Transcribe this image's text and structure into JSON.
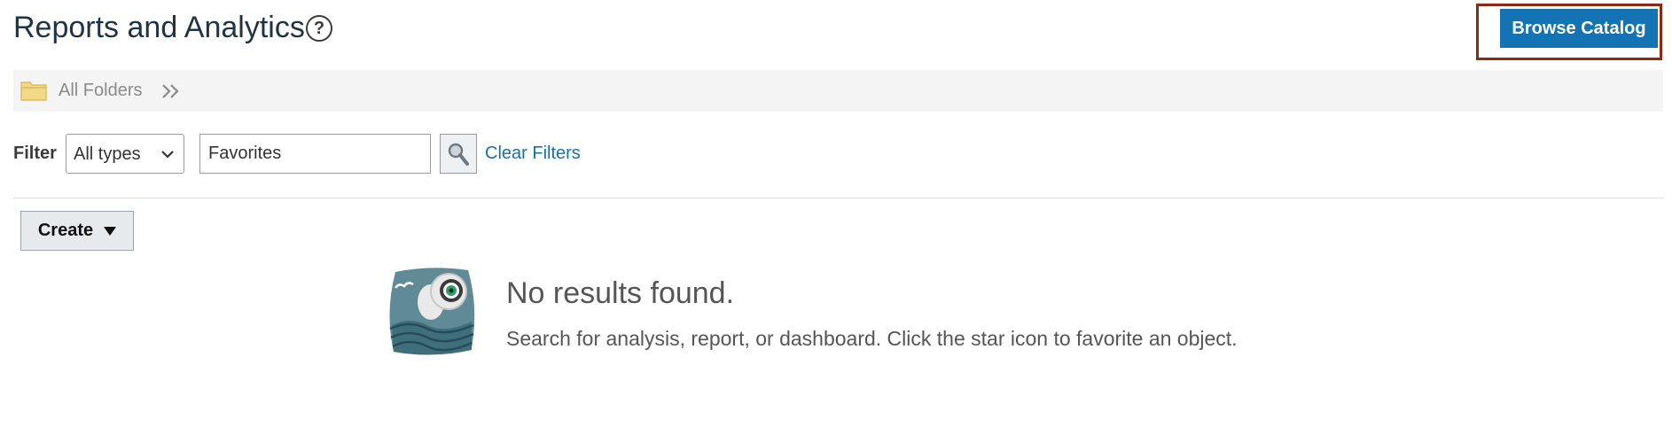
{
  "header": {
    "title": "Reports and Analytics",
    "help_icon": "help-circle-icon",
    "help_glyph": "?",
    "browse_catalog_label": "Browse Catalog",
    "browse_catalog_color": "#1473b3",
    "highlight_color": "#8b2a15"
  },
  "breadcrumb": {
    "icon": "folder-icon",
    "label": "All Folders",
    "chevron_icon": "double-chevron-right-icon"
  },
  "filter": {
    "label": "Filter",
    "type_select_value": "All types",
    "search_value": "Favorites",
    "search_icon": "search-icon",
    "clear_filters_label": "Clear Filters"
  },
  "toolbar": {
    "create_label": "Create",
    "create_icon": "caret-down-icon"
  },
  "empty_state": {
    "illustration": "binoculars-illustration",
    "title": "No results found.",
    "message": "Search for analysis, report, or dashboard. Click the star icon to favorite an object."
  }
}
